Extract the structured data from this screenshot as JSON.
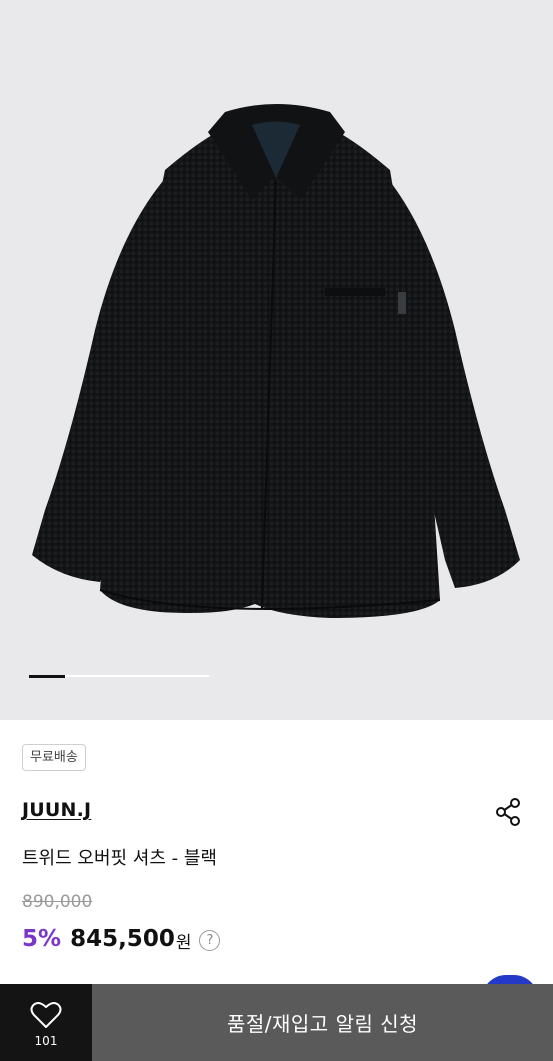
{
  "product": {
    "image_alt": "Black tweed overfit shirt",
    "badge": "무료배송",
    "brand": "JUUN.J",
    "name": "트위드 오버핏 셔츠 - 블랙",
    "original_price": "890,000",
    "discount": "5%",
    "price": "845,500",
    "currency": "원",
    "help": "?"
  },
  "carousel": {
    "current": 1,
    "total": 5
  },
  "bottom_bar": {
    "like_count": "101",
    "cta_label": "품절/재입고 알림 신청"
  },
  "colors": {
    "discount": "#7a36c9",
    "hero_bg": "#e9e9eb",
    "cta_bg": "#5a5a5a",
    "like_bg": "#141414",
    "fab": "#2439c8"
  },
  "icons": [
    "heart-icon",
    "share-icon",
    "question-icon"
  ]
}
